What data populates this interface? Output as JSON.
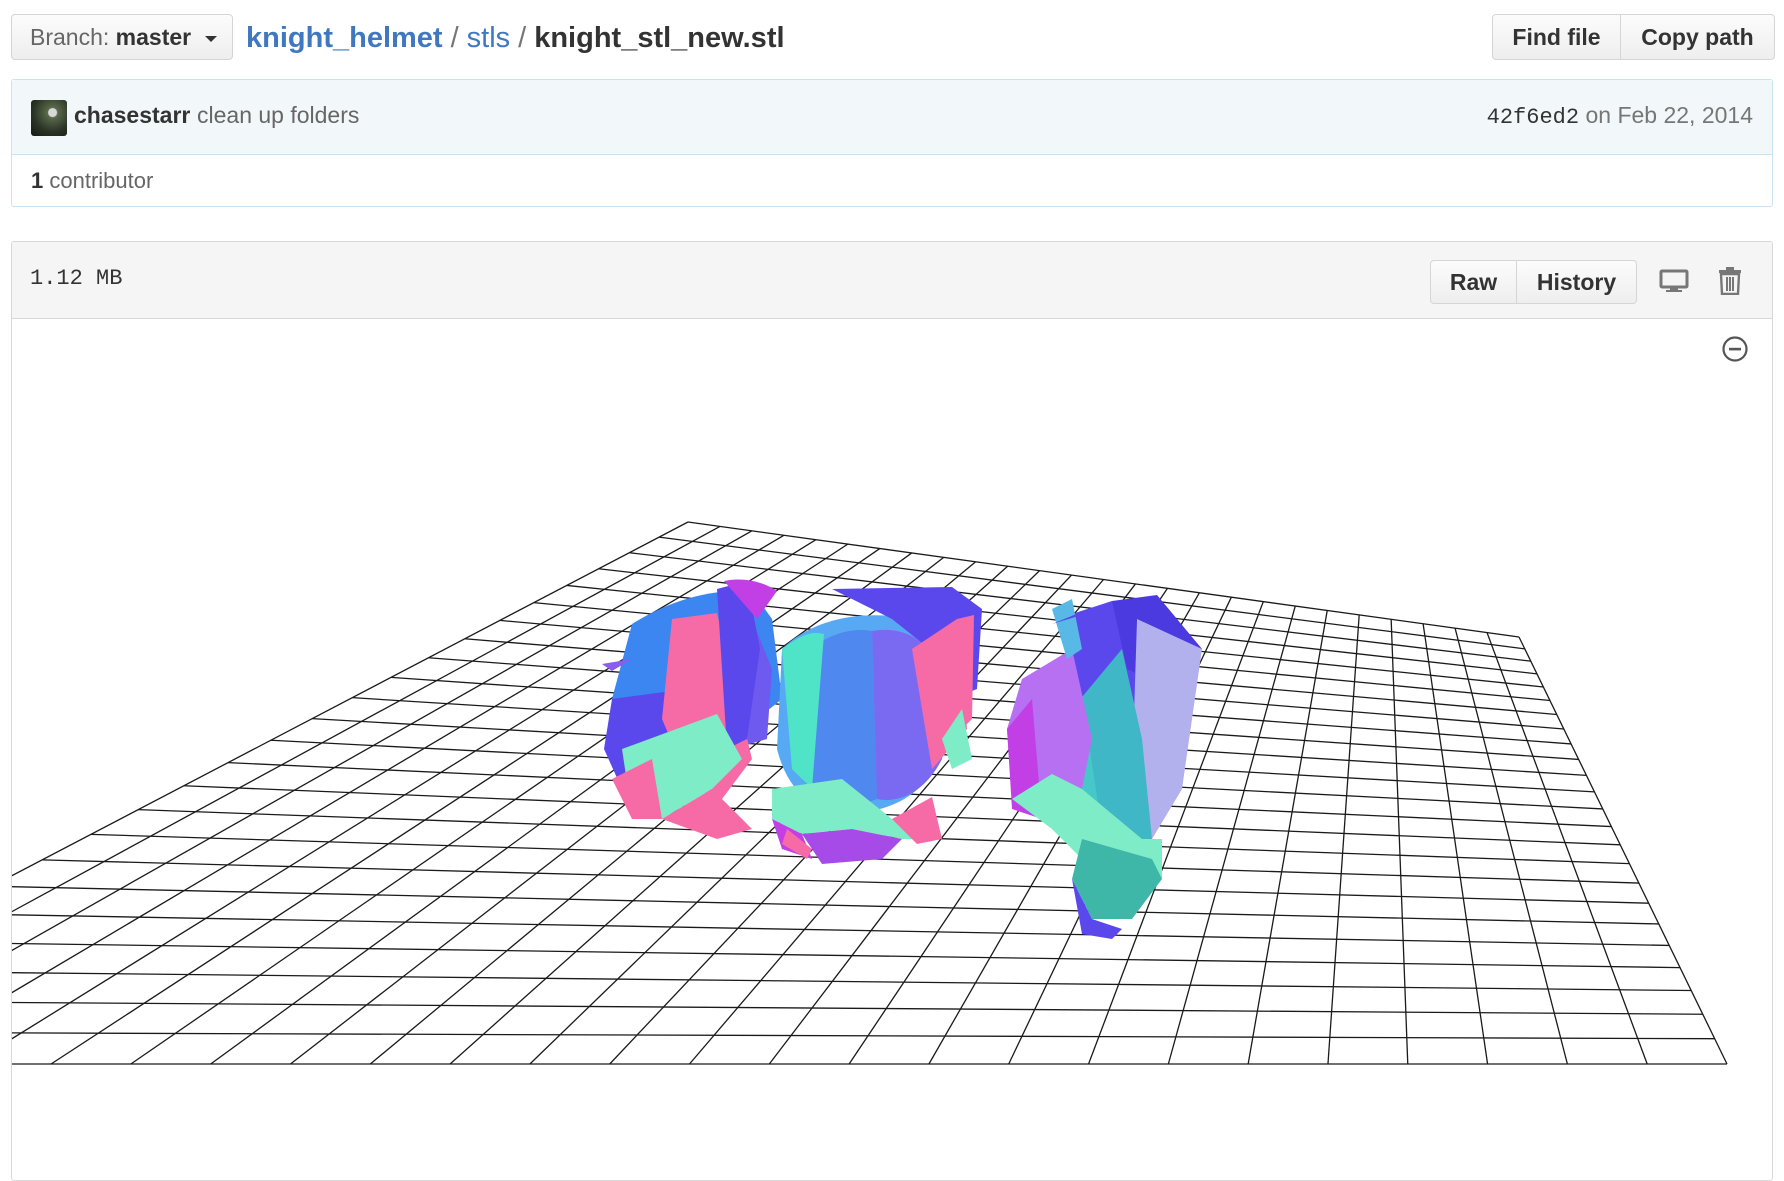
{
  "branch": {
    "label": "Branch:",
    "value": "master"
  },
  "breadcrumb": {
    "repo": "knight_helmet",
    "separator": "/",
    "directory": "stls",
    "file": "knight_stl_new.stl"
  },
  "path_actions": {
    "find_file": "Find file",
    "copy_path": "Copy path"
  },
  "commit": {
    "author": "chasestarr",
    "message": "clean up folders",
    "sha": "42f6ed2",
    "date_text": "on Feb 22, 2014"
  },
  "contributors": {
    "count": "1",
    "label": "contributor"
  },
  "file": {
    "size": "1.12 MB",
    "raw_label": "Raw",
    "history_label": "History",
    "icons": [
      "desktop-icon",
      "trash-icon",
      "zoom-out-icon"
    ]
  },
  "colors": {
    "link": "#4078c0",
    "model_pink": "#f66aa6",
    "model_blue": "#5a48ec",
    "model_mint": "#7eecc6",
    "model_magenta": "#c23fe6"
  }
}
